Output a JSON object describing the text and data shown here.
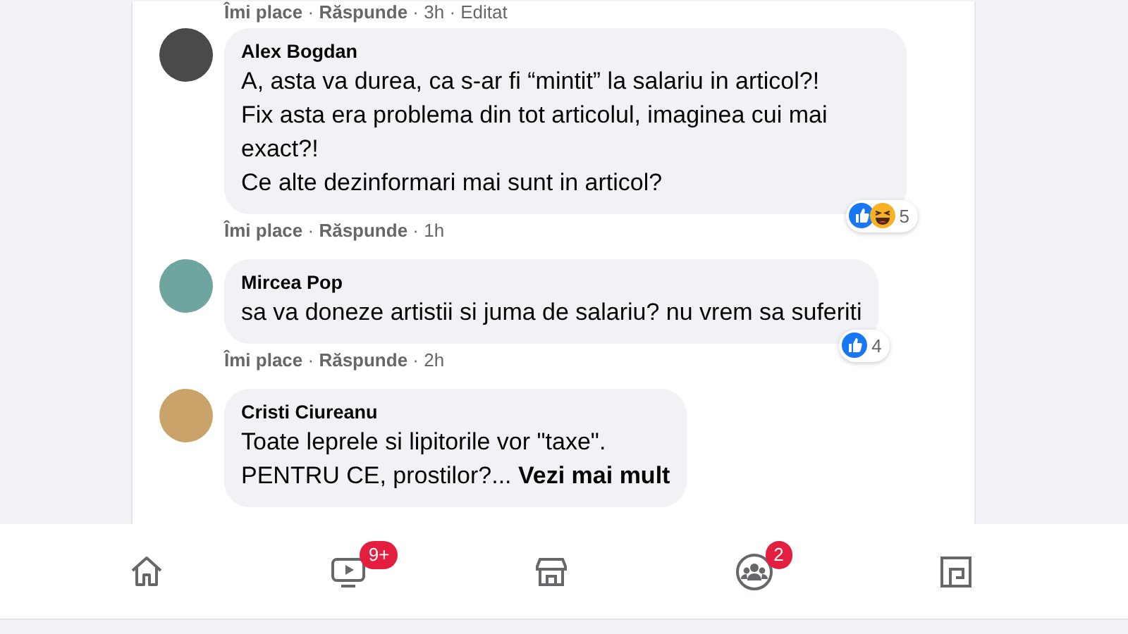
{
  "previous_comment_actions": {
    "like": "Îmi place",
    "separator": "·",
    "reply": "Răspunde",
    "time": "3h",
    "edited": "Editat"
  },
  "comments": [
    {
      "author": "Alex Bogdan",
      "paragraphs": [
        "A, asta va durea, ca s-ar fi “mintit” la salariu in articol?!",
        "Fix asta era problema din tot articolul, imaginea cui mai exact?!",
        "Ce alte dezinformari mai sunt in articol?"
      ],
      "reactions": [
        {
          "kind": "like"
        },
        {
          "kind": "haha"
        }
      ],
      "reaction_count": "5",
      "actions": {
        "like": "Îmi place",
        "separator": "·",
        "reply": "Răspunde",
        "time": "1h"
      }
    },
    {
      "author": "Mircea Pop",
      "paragraphs": [
        "sa va doneze artistii si juma de salariu? nu vrem sa suferiti"
      ],
      "reactions": [
        {
          "kind": "like"
        }
      ],
      "reaction_count": "4",
      "actions": {
        "like": "Îmi place",
        "separator": "·",
        "reply": "Răspunde",
        "time": "2h"
      }
    },
    {
      "author": "Cristi Ciureanu",
      "paragraphs": [
        "Toate leprele si lipitorile vor \"taxe\".",
        "PENTRU CE, prostilor?..."
      ],
      "see_more": "Vezi mai mult"
    }
  ],
  "bottom_nav": [
    {
      "kind": "home"
    },
    {
      "kind": "video",
      "badge": "9+"
    },
    {
      "kind": "marketplace"
    },
    {
      "kind": "groups",
      "badge": "2"
    },
    {
      "kind": "gaming"
    }
  ]
}
